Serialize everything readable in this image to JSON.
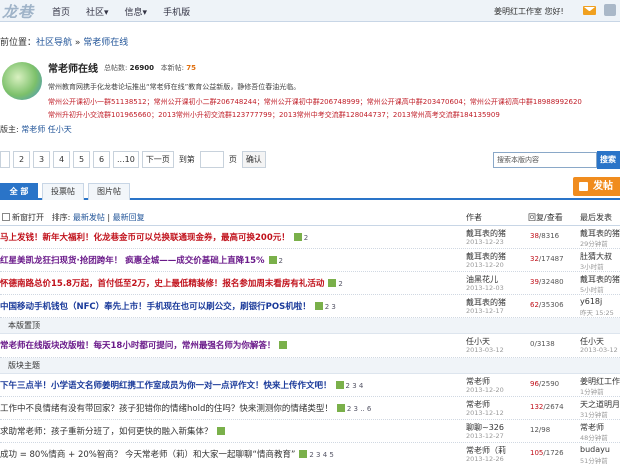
{
  "topbar": {
    "logo": "龙巷",
    "nav": [
      "首页",
      "社区▾",
      "信息▾",
      "手机版"
    ],
    "user": "姜明红工作室 您好!"
  },
  "breadcrumb": {
    "prefix": "前位置：",
    "section": "社区导航",
    "sep": " » ",
    "forum": "常老师在线"
  },
  "forum": {
    "title": "常老师在线",
    "stats_total_label": "总帖数:",
    "stats_total": "26900",
    "stats_new_label": "本新帖:",
    "stats_new": "75",
    "description": "常州教育网携手化龙巷论坛推出“常老师在线”教育公益新版，静修吾位春油光临。",
    "groups_line1": "常州公开课初小一群51138512；常州公开课初小二群206748244；常州公开课初中群206748999；常州公开课高中群203470604；常州公开课初高中群18988992620",
    "groups_line2": "常州升初升小交流群101965660；2013常州小升初交流群123777799；2013常州中考交流群128044737；2013常州高考交流群184135909",
    "moderator_label": "版主: ",
    "moderators": "常老师 任小天"
  },
  "pager": {
    "pages": [
      "2",
      "3",
      "4",
      "5",
      "6",
      "...10"
    ],
    "next": "下一页",
    "goto": "到第",
    "page_unit": "页",
    "confirm": "确认"
  },
  "search": {
    "placeholder": "搜索本版内容",
    "button": "搜索"
  },
  "tabs": [
    "全 部",
    "投票帖",
    "图片帖"
  ],
  "post_button": "发帖",
  "table_header": {
    "new_window": "新窗打开",
    "sort_label": "排序: ",
    "sort_new": "最新发帖",
    "sort_sep": " | ",
    "sort_reply": "最新回复",
    "author": "作者",
    "replies": "回复/查看",
    "last": "最后发表"
  },
  "rows_top": [
    {
      "title": "马上发钱！新年大福利！化龙巷金币可以兑换联通现金券，最高可换200元！",
      "style": "red",
      "pages": "2",
      "author": "戴耳表的猪",
      "date": "2013-12-23",
      "replies": "38",
      "views": "8316",
      "last_user": "戴耳表的猪",
      "last_time": "29分钟前"
    },
    {
      "title": "红星美凯龙狂扫现货·抢团跨年！ 疯惠全城——成交价基础上直降15%",
      "style": "purple",
      "pages": "2",
      "author": "戴耳表的猪",
      "date": "2013-12-20",
      "replies": "32",
      "views": "17487",
      "last_user": "肚猜大叔",
      "last_time": "3小时前"
    },
    {
      "title": "怀德南路总价15.8万起，首付低至2万，史上最低精装修！报名参加周末看房有礼活动",
      "style": "red",
      "pages": "2",
      "author": "油黑花儿",
      "date": "2013-12-03",
      "replies": "39",
      "views": "32480",
      "last_user": "戴耳表的猪",
      "last_time": "5小时前"
    },
    {
      "title": "中国移动手机钱包（NFC）奉先上市！手机现在也可以刷公交，刷银行POS机啦！",
      "style": "blue",
      "pages": "2 3",
      "author": "戴耳表的猪",
      "date": "2013-12-17",
      "replies": "62",
      "views": "35306",
      "last_user": "y618j",
      "last_time": "昨天 15:25"
    }
  ],
  "section_new": "本版置顶",
  "rows_pinned": [
    {
      "title": "常老师在线版块改版啦！每天18小时都可提问，常州最强名师为你解答！",
      "style": "purple",
      "pages": "",
      "author": "任小天",
      "date": "2013-03-12",
      "replies": "0",
      "views": "3138",
      "last_user": "任小天",
      "last_time": "2013-03-12"
    }
  ],
  "section_posts": "版块主题",
  "rows_normal": [
    {
      "title": "下午三点半！小学语文名师姜明红携工作室成员为你一对一点评作文！快来上传作文吧！",
      "style": "blue",
      "pages": "2 3 4",
      "author": "常老师",
      "date": "2013-12-20",
      "replies": "96",
      "views": "2590",
      "last_user": "姜明红工作室",
      "last_time": "1分钟前"
    },
    {
      "title": "工作中不良情绪有没有带回家？孩子犯错你的情绪hold的住吗？快来测测你的情绪类型！",
      "style": "plain",
      "pages": "2 3 .. 6",
      "author": "常老师",
      "date": "2013-12-12",
      "replies": "132",
      "views": "2674",
      "last_user": "天之道明月",
      "last_time": "31分钟前"
    },
    {
      "title": "求助常老师：孩子重新分班了，如何更快的融入新集体？",
      "style": "plain",
      "pages": "",
      "author": "聊聊~326",
      "date": "2013-12-27",
      "replies": "12",
      "views": "98",
      "last_user": "常老师",
      "last_time": "48分钟前"
    },
    {
      "title": "成功 = 80%情商 + 20%智商？ 今天常老师（莉）和大家一起聊聊“情商教育”",
      "style": "plain",
      "pages": "2 3 4 5",
      "author": "常老师（莉",
      "date": "2013-12-26",
      "replies": "105",
      "views": "1726",
      "last_user": "budayu",
      "last_time": "51分钟前"
    }
  ]
}
